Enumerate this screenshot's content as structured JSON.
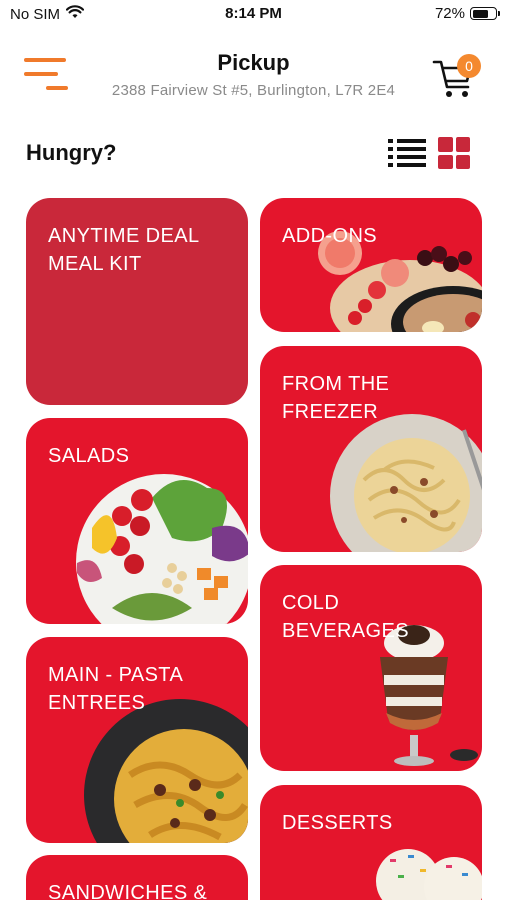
{
  "status_bar": {
    "carrier": "No SIM",
    "time": "8:14 PM",
    "battery_percent": "72%",
    "battery_level": 0.72,
    "wifi_icon": "wifi-icon"
  },
  "header": {
    "menu_icon": "menu-icon",
    "title": "Pickup",
    "address": "2388 Fairview St #5, Burlington, L7R 2E4",
    "cart_icon": "cart-icon",
    "cart_count": "0"
  },
  "section": {
    "title": "Hungry?",
    "list_view_icon": "list-view-icon",
    "grid_view_icon": "grid-view-icon"
  },
  "categories": [
    {
      "label": "ANYTIME DEAL MEAL KIT",
      "image": "none"
    },
    {
      "label": "ADD-ONS",
      "image": "add-ons-food-image"
    },
    {
      "label": "FROM THE FREEZER",
      "image": "pasta-plate-image"
    },
    {
      "label": "SALADS",
      "image": "salad-bowl-image"
    },
    {
      "label": "COLD BEVERAGES",
      "image": "milkshake-image"
    },
    {
      "label": "MAIN - PASTA ENTREES",
      "image": "pasta-bowl-image"
    },
    {
      "label": "DESSERTS",
      "image": "ice-cream-image"
    },
    {
      "label": "SANDWICHES &",
      "image": "sandwich-image"
    }
  ],
  "colors": {
    "accent_orange": "#f07a2b",
    "tile_red": "#e4152c",
    "tile_dark_red": "#c9283a",
    "grid_icon_red": "#c8283a"
  }
}
